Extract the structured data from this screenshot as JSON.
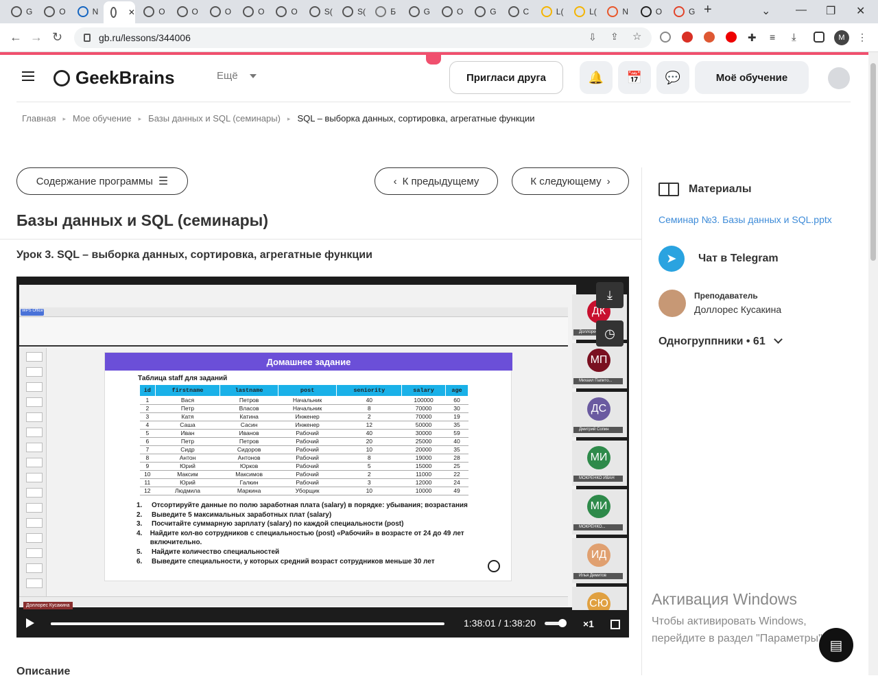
{
  "browser": {
    "tabs": [
      {
        "label": "G",
        "fav": "#555"
      },
      {
        "label": "О",
        "fav": "#555"
      },
      {
        "label": "N",
        "fav": "#1565c0"
      },
      {
        "label": "",
        "fav": "#555",
        "active": true
      },
      {
        "label": "О",
        "fav": "#555"
      },
      {
        "label": "О",
        "fav": "#555"
      },
      {
        "label": "О",
        "fav": "#555"
      },
      {
        "label": "О",
        "fav": "#555"
      },
      {
        "label": "О",
        "fav": "#555"
      },
      {
        "label": "S(",
        "fav": "#555"
      },
      {
        "label": "S(",
        "fav": "#555"
      },
      {
        "label": "Б",
        "fav": "#777"
      },
      {
        "label": "G",
        "fav": "#555"
      },
      {
        "label": "О",
        "fav": "#555"
      },
      {
        "label": "G",
        "fav": "#555"
      },
      {
        "label": "С",
        "fav": "#555"
      },
      {
        "label": "L(",
        "fav": "#f4b400"
      },
      {
        "label": "L(",
        "fav": "#f4b400"
      },
      {
        "label": "N",
        "fav": "#e8562a"
      },
      {
        "label": "О",
        "fav": "#222"
      },
      {
        "label": "G",
        "fav": "#e24329"
      }
    ],
    "new_tab": "+",
    "url": "gb.ru/lessons/344006",
    "win_min": "—",
    "win_restore": "❐",
    "win_close": "✕",
    "tab_close": "✕",
    "tab_search": "⌄"
  },
  "header": {
    "logo": "GeekBrains",
    "more": "Ещё",
    "invite": "Пригласи друга",
    "my_learning": "Моё обучение",
    "bell_icon": "🔔",
    "calendar_icon": "📅",
    "chat_icon": "💬"
  },
  "breadcrumbs": [
    "Главная",
    "Мое обучение",
    "Базы данных и SQL (семинары)",
    "SQL – выборка данных, сортировка, агрегатные функции"
  ],
  "nav": {
    "contents": "Содержание программы",
    "prev": "К предыдущему",
    "next": "К следующему"
  },
  "course_title": "Базы данных и SQL (семинары)",
  "lesson_title": "Урок 3. SQL – выборка данных, сортировка, агрегатные функции",
  "slide": {
    "title": "Домашнее задание",
    "subtitle": "Таблица staff для заданий",
    "columns": [
      "id",
      "firstname",
      "lastname",
      "post",
      "seniority",
      "salary",
      "age"
    ],
    "rows": [
      [
        "1",
        "Вася",
        "Петров",
        "Начальник",
        "40",
        "100000",
        "60"
      ],
      [
        "2",
        "Петр",
        "Власов",
        "Начальник",
        "8",
        "70000",
        "30"
      ],
      [
        "3",
        "Катя",
        "Катина",
        "Инженер",
        "2",
        "70000",
        "19"
      ],
      [
        "4",
        "Саша",
        "Сасин",
        "Инженер",
        "12",
        "50000",
        "35"
      ],
      [
        "5",
        "Иван",
        "Иванов",
        "Рабочий",
        "40",
        "30000",
        "59"
      ],
      [
        "6",
        "Петр",
        "Петров",
        "Рабочий",
        "20",
        "25000",
        "40"
      ],
      [
        "7",
        "Сидр",
        "Сидоров",
        "Рабочий",
        "10",
        "20000",
        "35"
      ],
      [
        "8",
        "Антон",
        "Антонов",
        "Рабочий",
        "8",
        "19000",
        "28"
      ],
      [
        "9",
        "Юрий",
        "Юрков",
        "Рабочий",
        "5",
        "15000",
        "25"
      ],
      [
        "10",
        "Максим",
        "Максимов",
        "Рабочий",
        "2",
        "11000",
        "22"
      ],
      [
        "11",
        "Юрий",
        "Галкин",
        "Рабочий",
        "3",
        "12000",
        "24"
      ],
      [
        "12",
        "Людмила",
        "Маркина",
        "Уборщик",
        "10",
        "10000",
        "49"
      ]
    ],
    "tasks": [
      {
        "n": "1.",
        "t": "Отсортируйте данные по полю заработная плата (salary) в порядке: убывания; возрастания"
      },
      {
        "n": "2.",
        "t": "Выведите 5 максимальных заработных плат (salary)"
      },
      {
        "n": "3.",
        "t": "Посчитайте суммарную зарплату (salary) по каждой специальности (post)"
      },
      {
        "n": "4.",
        "t": "Найдите кол-во сотрудников с специальностью (post) «Рабочий» в возрасте от 24 до 49 лет включительно."
      },
      {
        "n": "5.",
        "t": "Найдите количество специальностей"
      },
      {
        "n": "6.",
        "t": "Выведите специальности, у которых средний возраст сотрудников меньше 30 лет"
      }
    ],
    "speaker": "Доллорес Кусакина",
    "wps": "WPS Office"
  },
  "participants": [
    {
      "initials": "ДК",
      "color": "#c8102e",
      "name": "Доллорес"
    },
    {
      "initials": "МП",
      "color": "#7a1020",
      "name": "Михаил Папито..."
    },
    {
      "initials": "ДС",
      "color": "#6a5aa0",
      "name": "Дмитрий Сопин"
    },
    {
      "initials": "МИ",
      "color": "#2e8a4a",
      "name": "МОКРЕНКО ИВАН"
    },
    {
      "initials": "МИ",
      "color": "#2e8a4a",
      "name": "МОКРЕНКО..."
    },
    {
      "initials": "ИД",
      "color": "#e0a070",
      "name": "Илья Демитов"
    },
    {
      "initials": "СЮ",
      "color": "#e0a040",
      "name": ""
    }
  ],
  "player": {
    "time": "1:38:01  /  1:38:20",
    "speed": "×1",
    "progress": 0.998
  },
  "sidebar": {
    "materials": "Материалы",
    "file": "Семинар №3. Базы данных и SQL.pptx",
    "telegram": "Чат в Telegram",
    "teacher_role": "Преподаватель",
    "teacher_name": "Доллорес Кусакина",
    "classmates": "Одногруппники • 61"
  },
  "description": "Описание",
  "windows": {
    "line1": "Активация Windows",
    "line2": "Чтобы активировать Windows, перейдите в раздел \"Параметры\"."
  }
}
